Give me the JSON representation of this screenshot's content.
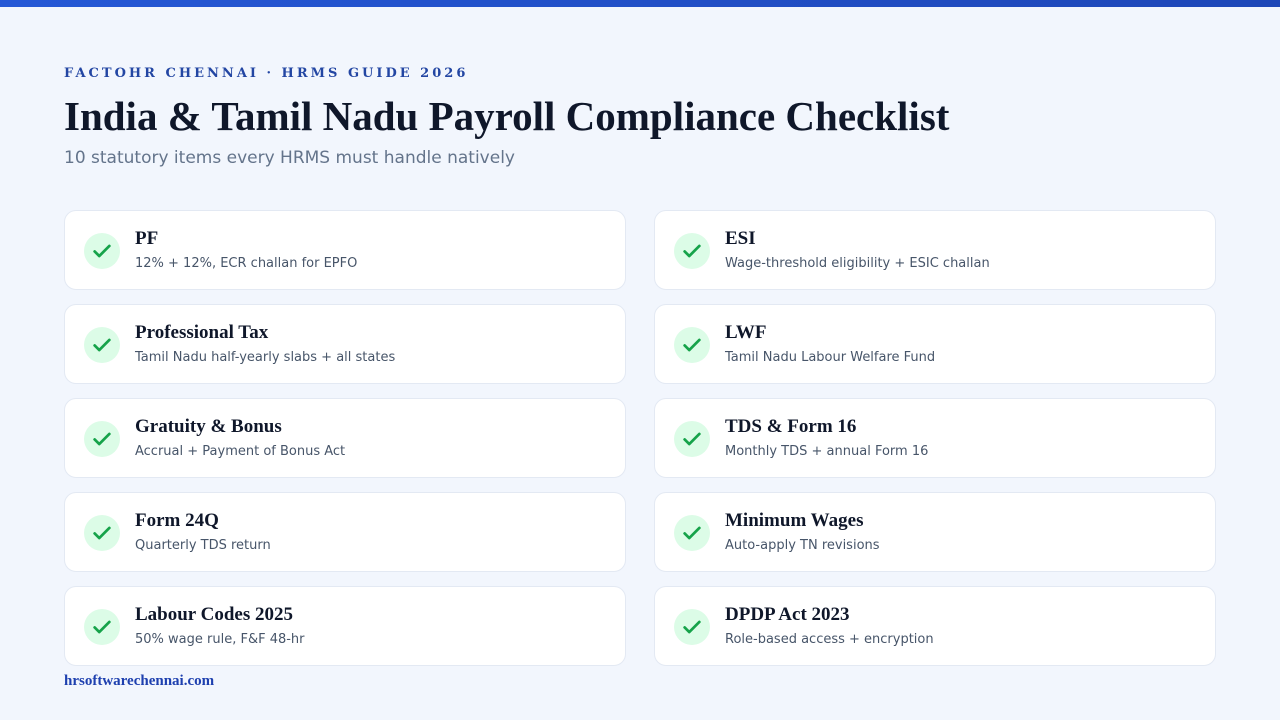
{
  "header": {
    "eyebrow": "FACTOHR CHENNAI · HRMS GUIDE 2026",
    "title": "India & Tamil Nadu Payroll Compliance Checklist",
    "subtitle": "10 statutory items every HRMS must handle natively"
  },
  "checklist": [
    {
      "title": "PF",
      "desc": "12% + 12%, ECR challan for EPFO",
      "icon": "check-icon"
    },
    {
      "title": "ESI",
      "desc": "Wage-threshold eligibility + ESIC challan",
      "icon": "check-icon"
    },
    {
      "title": "Professional Tax",
      "desc": "Tamil Nadu half-yearly slabs + all states",
      "icon": "check-icon"
    },
    {
      "title": "LWF",
      "desc": "Tamil Nadu Labour Welfare Fund",
      "icon": "check-icon"
    },
    {
      "title": "Gratuity & Bonus",
      "desc": "Accrual + Payment of Bonus Act",
      "icon": "check-icon"
    },
    {
      "title": "TDS & Form 16",
      "desc": "Monthly TDS + annual Form 16",
      "icon": "check-icon"
    },
    {
      "title": "Form 24Q",
      "desc": "Quarterly TDS return",
      "icon": "check-icon"
    },
    {
      "title": "Minimum Wages",
      "desc": "Auto-apply TN revisions",
      "icon": "check-icon"
    },
    {
      "title": "Labour Codes 2025",
      "desc": "50% wage rule, F&F 48-hr",
      "icon": "check-icon"
    },
    {
      "title": "DPDP Act 2023",
      "desc": "Role-based access + encryption",
      "icon": "check-icon"
    }
  ],
  "footer": {
    "url": "hrsoftwarechennai.com"
  },
  "colors": {
    "accent": "#2346a3",
    "check_bg": "#dcfce7",
    "check": "#16a34a",
    "page_bg": "#f2f6fd"
  }
}
